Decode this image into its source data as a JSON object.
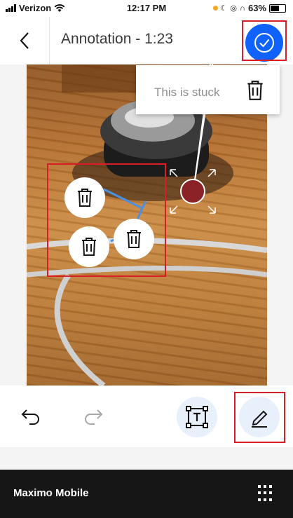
{
  "status_bar": {
    "carrier": "Verizon",
    "time": "12:17 PM",
    "battery": "63%"
  },
  "header": {
    "title": "Annotation - 1:23",
    "back_icon": "chevron-left-icon",
    "confirm_icon": "checkmark-circle-icon"
  },
  "popup": {
    "label": "This is stuck",
    "icon": "trash-icon"
  },
  "annotation": {
    "marker_color": "#8b2228",
    "line_color": "#4a90e2",
    "handle_icons": [
      "trash-icon",
      "trash-icon",
      "trash-icon"
    ]
  },
  "toolbar": {
    "undo_icon": "undo-icon",
    "redo_icon": "redo-icon",
    "text_tool_icon": "text-box-icon",
    "draw_tool_icon": "pencil-icon"
  },
  "bottom_bar": {
    "app_name": "Maximo Mobile",
    "menu_icon": "app-grid-icon"
  },
  "colors": {
    "accent": "#0f62fe",
    "highlight": "#da1e28"
  }
}
